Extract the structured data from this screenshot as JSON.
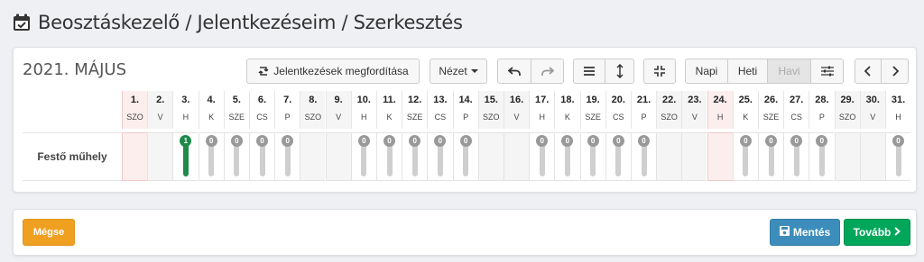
{
  "header": {
    "title": "Beosztáskezelő / Jelentkezéseim / Szerkesztés",
    "icon": "calendar-check-icon"
  },
  "toolbar": {
    "month_label": "2021. MÁJUS",
    "invert_label": "Jelentkezések megfordítása",
    "view_label": "Nézet",
    "day_label": "Napi",
    "week_label": "Heti",
    "month_view_label": "Havi"
  },
  "schedule": {
    "row_label": "Festő műhely",
    "days": [
      {
        "num": "1.",
        "name": "SZO",
        "type": "holiday",
        "slot": null
      },
      {
        "num": "2.",
        "name": "V",
        "type": "weekend",
        "slot": null
      },
      {
        "num": "3.",
        "name": "H",
        "type": "work",
        "slot": "1"
      },
      {
        "num": "4.",
        "name": "K",
        "type": "work",
        "slot": "0"
      },
      {
        "num": "5.",
        "name": "SZE",
        "type": "work",
        "slot": "0"
      },
      {
        "num": "6.",
        "name": "CS",
        "type": "work",
        "slot": "0"
      },
      {
        "num": "7.",
        "name": "P",
        "type": "work",
        "slot": "0"
      },
      {
        "num": "8.",
        "name": "SZO",
        "type": "weekend",
        "slot": null
      },
      {
        "num": "9.",
        "name": "V",
        "type": "weekend",
        "slot": null
      },
      {
        "num": "10.",
        "name": "H",
        "type": "work",
        "slot": "0"
      },
      {
        "num": "11.",
        "name": "K",
        "type": "work",
        "slot": "0"
      },
      {
        "num": "12.",
        "name": "SZE",
        "type": "work",
        "slot": "0"
      },
      {
        "num": "13.",
        "name": "CS",
        "type": "work",
        "slot": "0"
      },
      {
        "num": "14.",
        "name": "P",
        "type": "work",
        "slot": "0"
      },
      {
        "num": "15.",
        "name": "SZO",
        "type": "weekend",
        "slot": null
      },
      {
        "num": "16.",
        "name": "V",
        "type": "weekend",
        "slot": null
      },
      {
        "num": "17.",
        "name": "H",
        "type": "work",
        "slot": "0"
      },
      {
        "num": "18.",
        "name": "K",
        "type": "work",
        "slot": "0"
      },
      {
        "num": "19.",
        "name": "SZE",
        "type": "work",
        "slot": "0"
      },
      {
        "num": "20.",
        "name": "CS",
        "type": "work",
        "slot": "0"
      },
      {
        "num": "21.",
        "name": "P",
        "type": "work",
        "slot": "0"
      },
      {
        "num": "22.",
        "name": "SZO",
        "type": "weekend",
        "slot": null
      },
      {
        "num": "23.",
        "name": "V",
        "type": "weekend",
        "slot": null
      },
      {
        "num": "24.",
        "name": "H",
        "type": "holiday",
        "slot": null
      },
      {
        "num": "25.",
        "name": "K",
        "type": "work",
        "slot": "0"
      },
      {
        "num": "26.",
        "name": "SZE",
        "type": "work",
        "slot": "0"
      },
      {
        "num": "27.",
        "name": "CS",
        "type": "work",
        "slot": "0"
      },
      {
        "num": "28.",
        "name": "P",
        "type": "work",
        "slot": "0"
      },
      {
        "num": "29.",
        "name": "SZO",
        "type": "weekend",
        "slot": null
      },
      {
        "num": "30.",
        "name": "V",
        "type": "weekend",
        "slot": null
      },
      {
        "num": "31.",
        "name": "H",
        "type": "work",
        "slot": "0"
      }
    ]
  },
  "footer": {
    "cancel_label": "Mégse",
    "save_label": "Mentés",
    "next_label": "Tovább"
  },
  "colors": {
    "cancel": "#f0a020",
    "save": "#3c8dbc",
    "next": "#00a65a",
    "selected": "#1e8a4a",
    "holiday": "#fdeeee"
  }
}
